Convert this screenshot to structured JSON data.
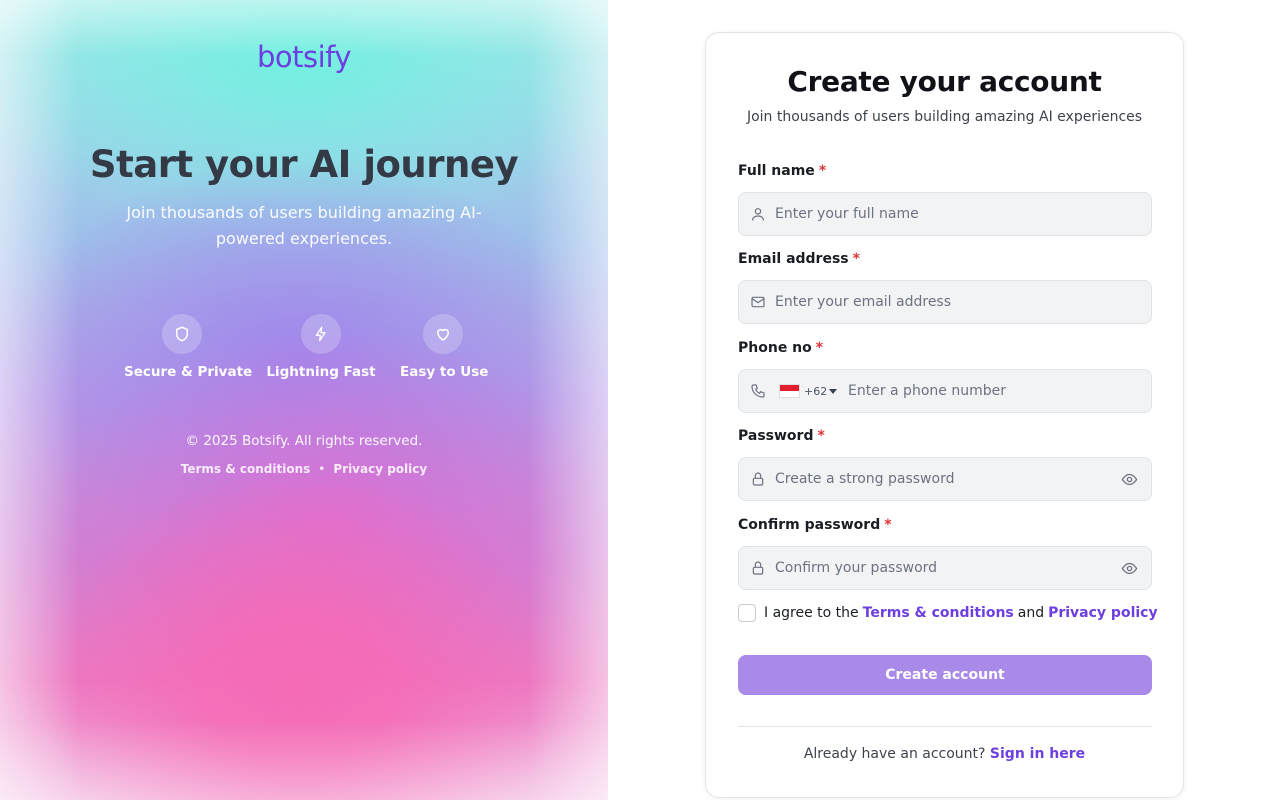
{
  "hero": {
    "brand": "botsify",
    "title": "Start your AI journey",
    "subtitle": "Join thousands of users building amazing AI-powered experiences.",
    "features": [
      {
        "label": "Secure & Private",
        "icon": "shield-icon"
      },
      {
        "label": "Lightning Fast",
        "icon": "bolt-icon"
      },
      {
        "label": "Easy to Use",
        "icon": "heart-icon"
      }
    ],
    "copyright": "© 2025 Botsify. All rights reserved.",
    "terms_link": "Terms & conditions",
    "separator": "•",
    "privacy_link": "Privacy policy"
  },
  "form": {
    "title": "Create your account",
    "subtitle": "Join thousands of users building amazing AI experiences",
    "required_mark": "*",
    "full_name": {
      "label": "Full name",
      "placeholder": "Enter your full name",
      "value": ""
    },
    "email": {
      "label": "Email address",
      "placeholder": "Enter your email address",
      "value": ""
    },
    "phone": {
      "label": "Phone no",
      "placeholder": "Enter a phone number",
      "dial_code": "+62",
      "country": "Indonesia",
      "value": ""
    },
    "password": {
      "label": "Password",
      "placeholder": "Create a strong password",
      "value": ""
    },
    "confirm_password": {
      "label": "Confirm password",
      "placeholder": "Confirm your password",
      "value": ""
    },
    "agree": {
      "prefix": "I agree to the",
      "terms": "Terms & conditions",
      "and": "and",
      "privacy": "Privacy policy",
      "checked": false
    },
    "submit_label": "Create account",
    "signin_prompt": "Already have an account?",
    "signin_link": "Sign in here"
  },
  "colors": {
    "accent": "#6d3fe0",
    "button": "#a98ae8",
    "required": "#e0333b"
  }
}
